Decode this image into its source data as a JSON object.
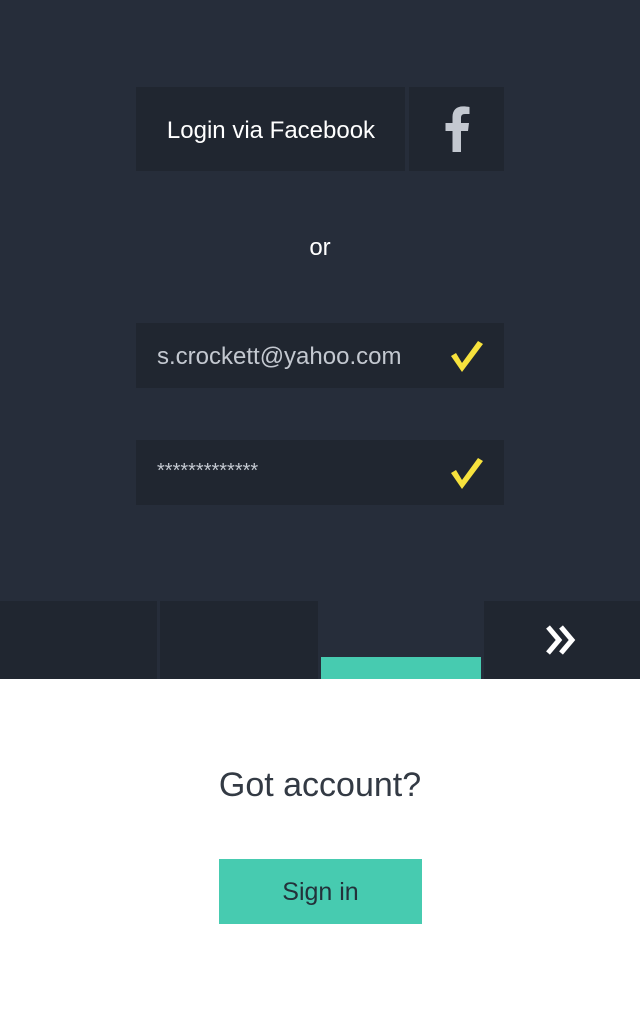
{
  "login": {
    "facebook_label": "Login via Facebook",
    "facebook_icon": "facebook-f-icon",
    "or_text": "or"
  },
  "form": {
    "email_value": "s.crockett@yahoo.com",
    "password_value": "*************",
    "valid_icon": "checkmark-icon"
  },
  "tabs": {
    "active_index": 3,
    "next_icon": "double-chevron-right-icon"
  },
  "signin": {
    "title": "Got account?",
    "button_label": "Sign in"
  },
  "colors": {
    "background_dark": "#262d3a",
    "panel_dark": "#202630",
    "accent_teal": "#47cbb0",
    "check_yellow": "#f7e23d"
  }
}
